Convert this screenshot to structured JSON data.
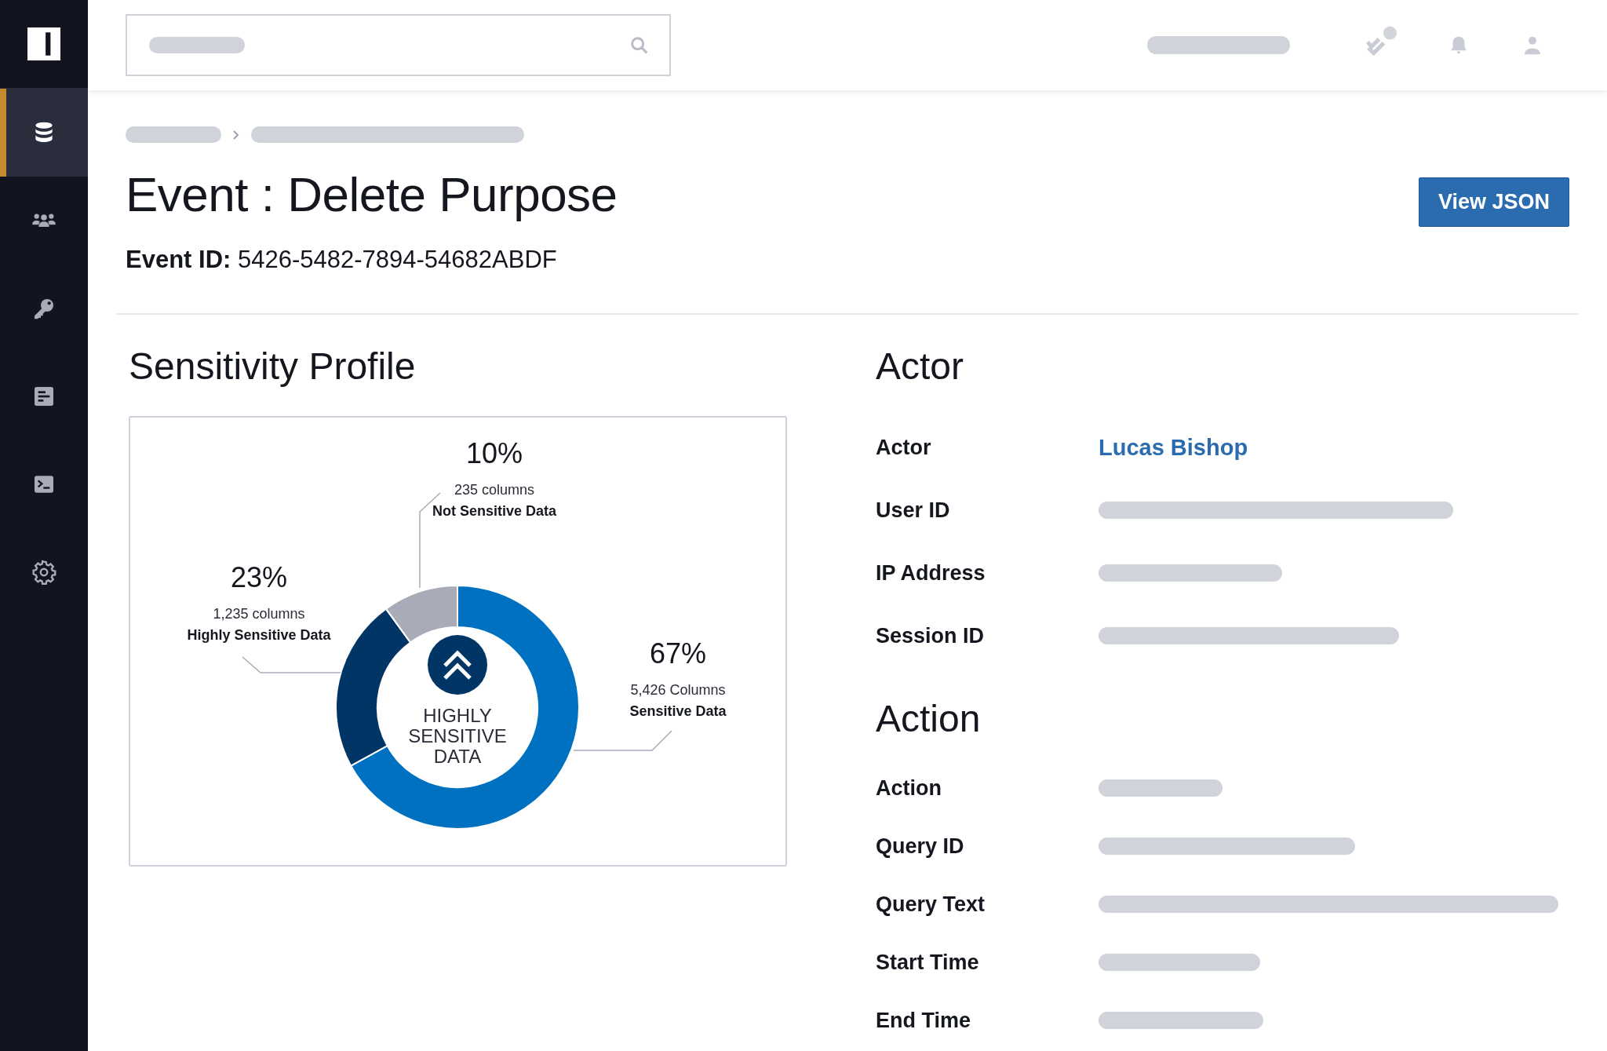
{
  "sidebar": {
    "items": [
      {
        "selected": true
      },
      {
        "selected": false
      },
      {
        "selected": false
      },
      {
        "selected": false
      },
      {
        "selected": false
      },
      {
        "selected": false
      }
    ]
  },
  "header": {
    "title": "Event : Delete Purpose",
    "event_id": "**Event ID:** 5426-5482-7894-54682ABDF",
    "button": "View JSON"
  },
  "sensitivity_profile": {
    "heading": "Sensitivity Profile",
    "chart_data": {
      "type": "donut",
      "categories": [
        "Sensitive Data",
        "Highly Sensitive Data",
        "Not Sensitive Data"
      ],
      "values": [
        67,
        23,
        10
      ],
      "colors": [
        "#0070c0",
        "#003566",
        "#a9abb8"
      ]
    },
    "center_label": "HIGHLY SENSITIVE DATA",
    "callouts": [
      {
        "percent": "67%",
        "count": "5,426 Columns"
      },
      {
        "percent": "23%",
        "count": "1,235 columns"
      },
      {
        "percent": "10%",
        "count": "235 columns"
      }
    ]
  },
  "actor": {
    "heading": "Actor",
    "rows": [
      {
        "label": "Actor",
        "kind": "link",
        "value": "Lucas Bishop"
      },
      {
        "label": "User ID",
        "kind": "placeholder"
      },
      {
        "label": "IP Address",
        "kind": "placeholder"
      },
      {
        "label": "Session ID",
        "kind": "placeholder"
      }
    ]
  },
  "action": {
    "heading": "Action",
    "rows": [
      {
        "label": "Action",
        "kind": "placeholder"
      },
      {
        "label": "Query ID",
        "kind": "placeholder"
      },
      {
        "label": "Query Text",
        "kind": "placeholder"
      },
      {
        "label": "Start Time",
        "kind": "placeholder"
      },
      {
        "label": "End Time",
        "kind": "placeholder"
      }
    ]
  }
}
